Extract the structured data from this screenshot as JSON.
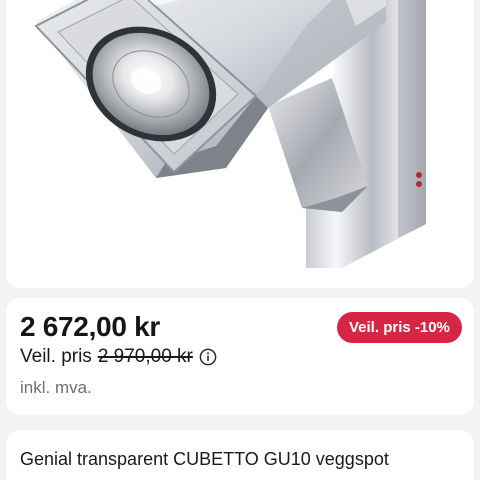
{
  "product": {
    "image_alt": "Product photo of a chrome cube wall spotlight",
    "price": "2 672,00 kr",
    "reference_label": "Veil. pris",
    "reference_price": "2 970,00 kr",
    "vat_note": "inkl. mva.",
    "discount_badge": "Veil. pris -10%",
    "title": "Genial transparent CUBETTO GU10 veggspot"
  },
  "colors": {
    "badge_background": "#d72544",
    "badge_text": "#ffffff",
    "page_background": "#f2f2f4",
    "card_background": "#ffffff"
  },
  "icons": {
    "info": "info-circle-icon"
  }
}
